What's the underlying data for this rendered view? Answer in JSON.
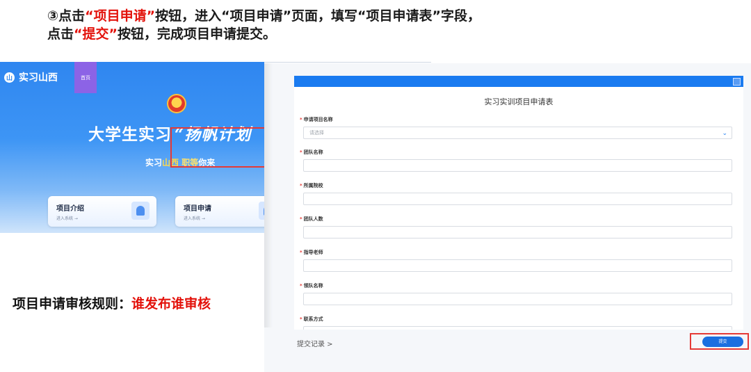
{
  "instruction": {
    "line1": [
      "③点击",
      "“项目申请”",
      "按钮，进入“项目申请”页面，填写“项目申请表”字段，"
    ],
    "line2": [
      "点击",
      "“提交”",
      "按钮，完成项目申请提交。"
    ]
  },
  "hero": {
    "brand": "实习山西",
    "brand_logo": "山",
    "home_tab": "首页",
    "title": "大学生实习",
    "title_script": "“扬帆计划",
    "slogan": [
      "实习",
      "山西",
      " ",
      "职等",
      "你来"
    ],
    "cards": [
      {
        "title": "项目介绍",
        "sub": "进入系统 →"
      },
      {
        "title": "项目申请",
        "sub": "进入系统 →"
      }
    ]
  },
  "rule": {
    "label": "项目申请审核规则：",
    "value": "谁发布谁审核"
  },
  "form": {
    "title": "实习实训项目申请表",
    "fields": [
      {
        "label": "申请项目名称",
        "required": true,
        "placeholder": "请选择",
        "type": "select"
      },
      {
        "label": "团队名称",
        "required": true,
        "placeholder": "",
        "type": "text"
      },
      {
        "label": "所属院校",
        "required": true,
        "placeholder": "",
        "type": "text"
      },
      {
        "label": "团队人数",
        "required": true,
        "placeholder": "",
        "type": "text"
      },
      {
        "label": "指导老师",
        "required": true,
        "placeholder": "",
        "type": "text"
      },
      {
        "label": "领队名称",
        "required": true,
        "placeholder": "",
        "type": "text"
      },
      {
        "label": "联系方式",
        "required": true,
        "placeholder": "",
        "type": "text"
      }
    ]
  },
  "footer": {
    "history": "提交记录 >",
    "submit": "提交"
  },
  "colors": {
    "accent": "#1a7bf0",
    "highlight": "#e53935",
    "emphasis": "#e3120b"
  }
}
